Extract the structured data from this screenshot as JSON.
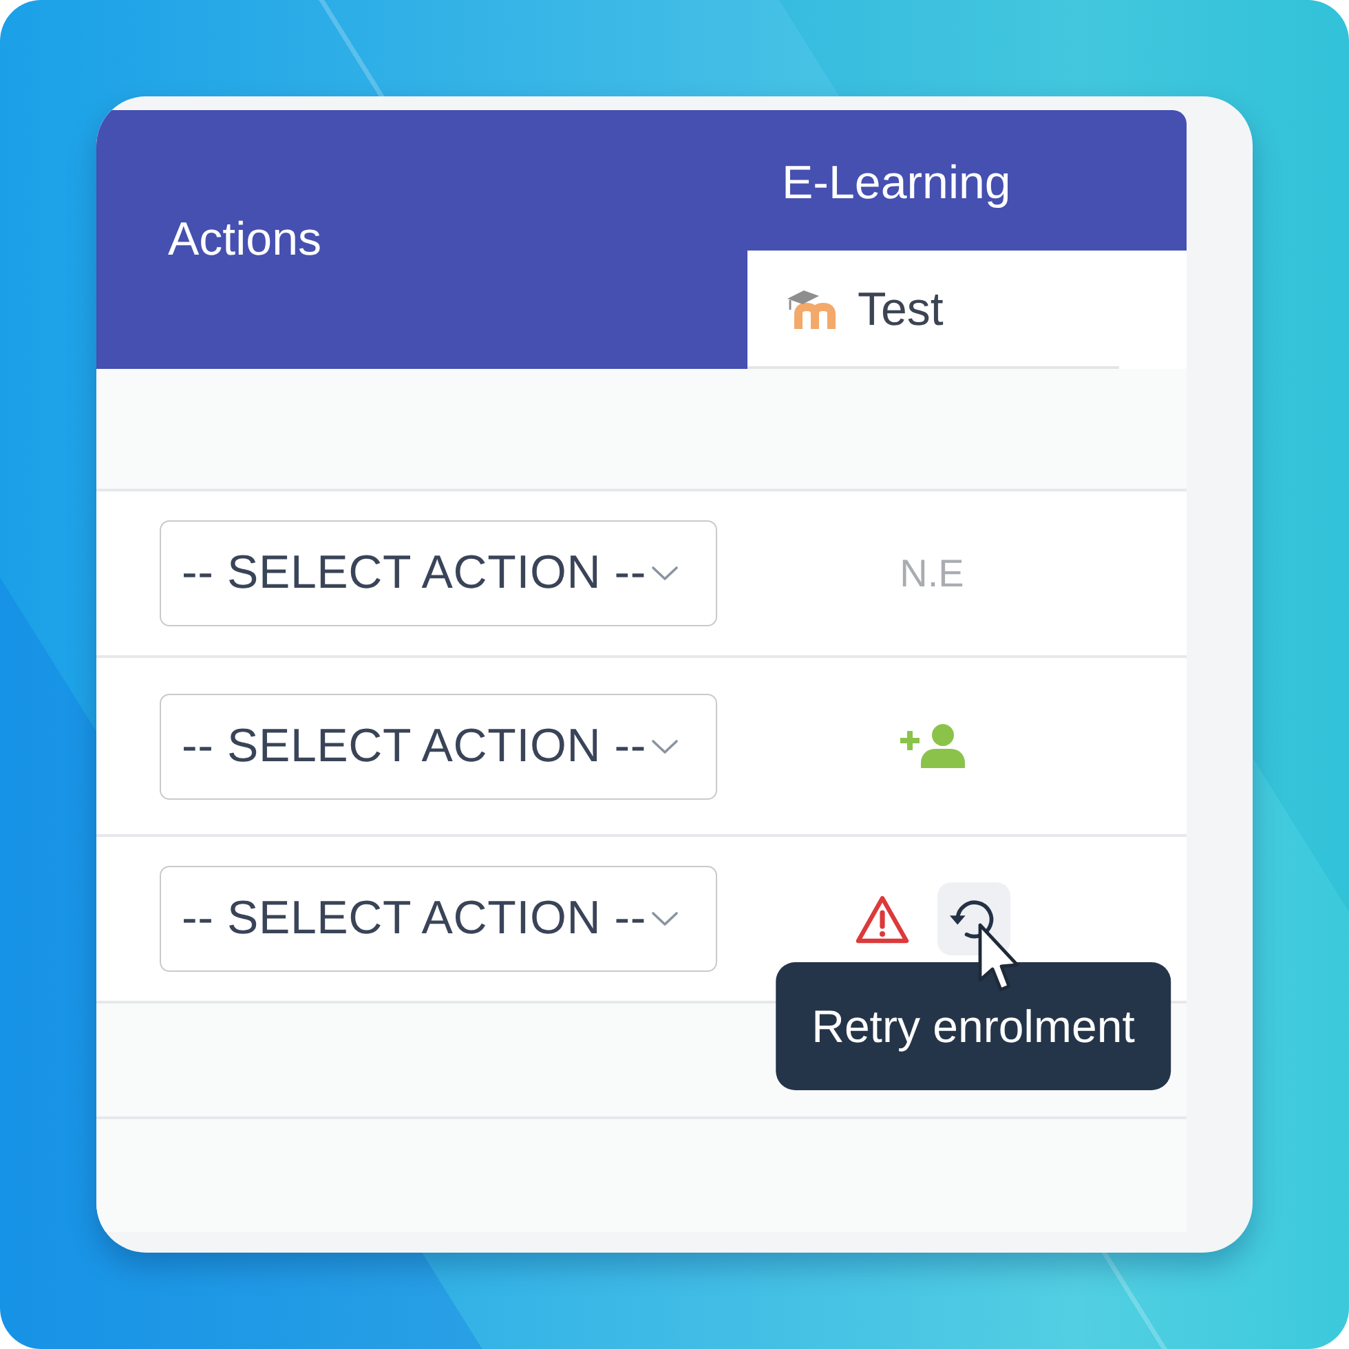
{
  "table": {
    "header": {
      "actions": "Actions",
      "group": "E-Learning",
      "course": "Test"
    },
    "rows": [
      {
        "action": "-- SELECT ACTION --",
        "elearning": {
          "kind": "status",
          "text": "N.E"
        }
      },
      {
        "action": "-- SELECT ACTION --",
        "elearning": {
          "kind": "enrol"
        }
      },
      {
        "action": "-- SELECT ACTION --",
        "elearning": {
          "kind": "error",
          "retry": {
            "hovered": true,
            "tooltip": "Retry enrolment"
          }
        }
      }
    ]
  }
}
